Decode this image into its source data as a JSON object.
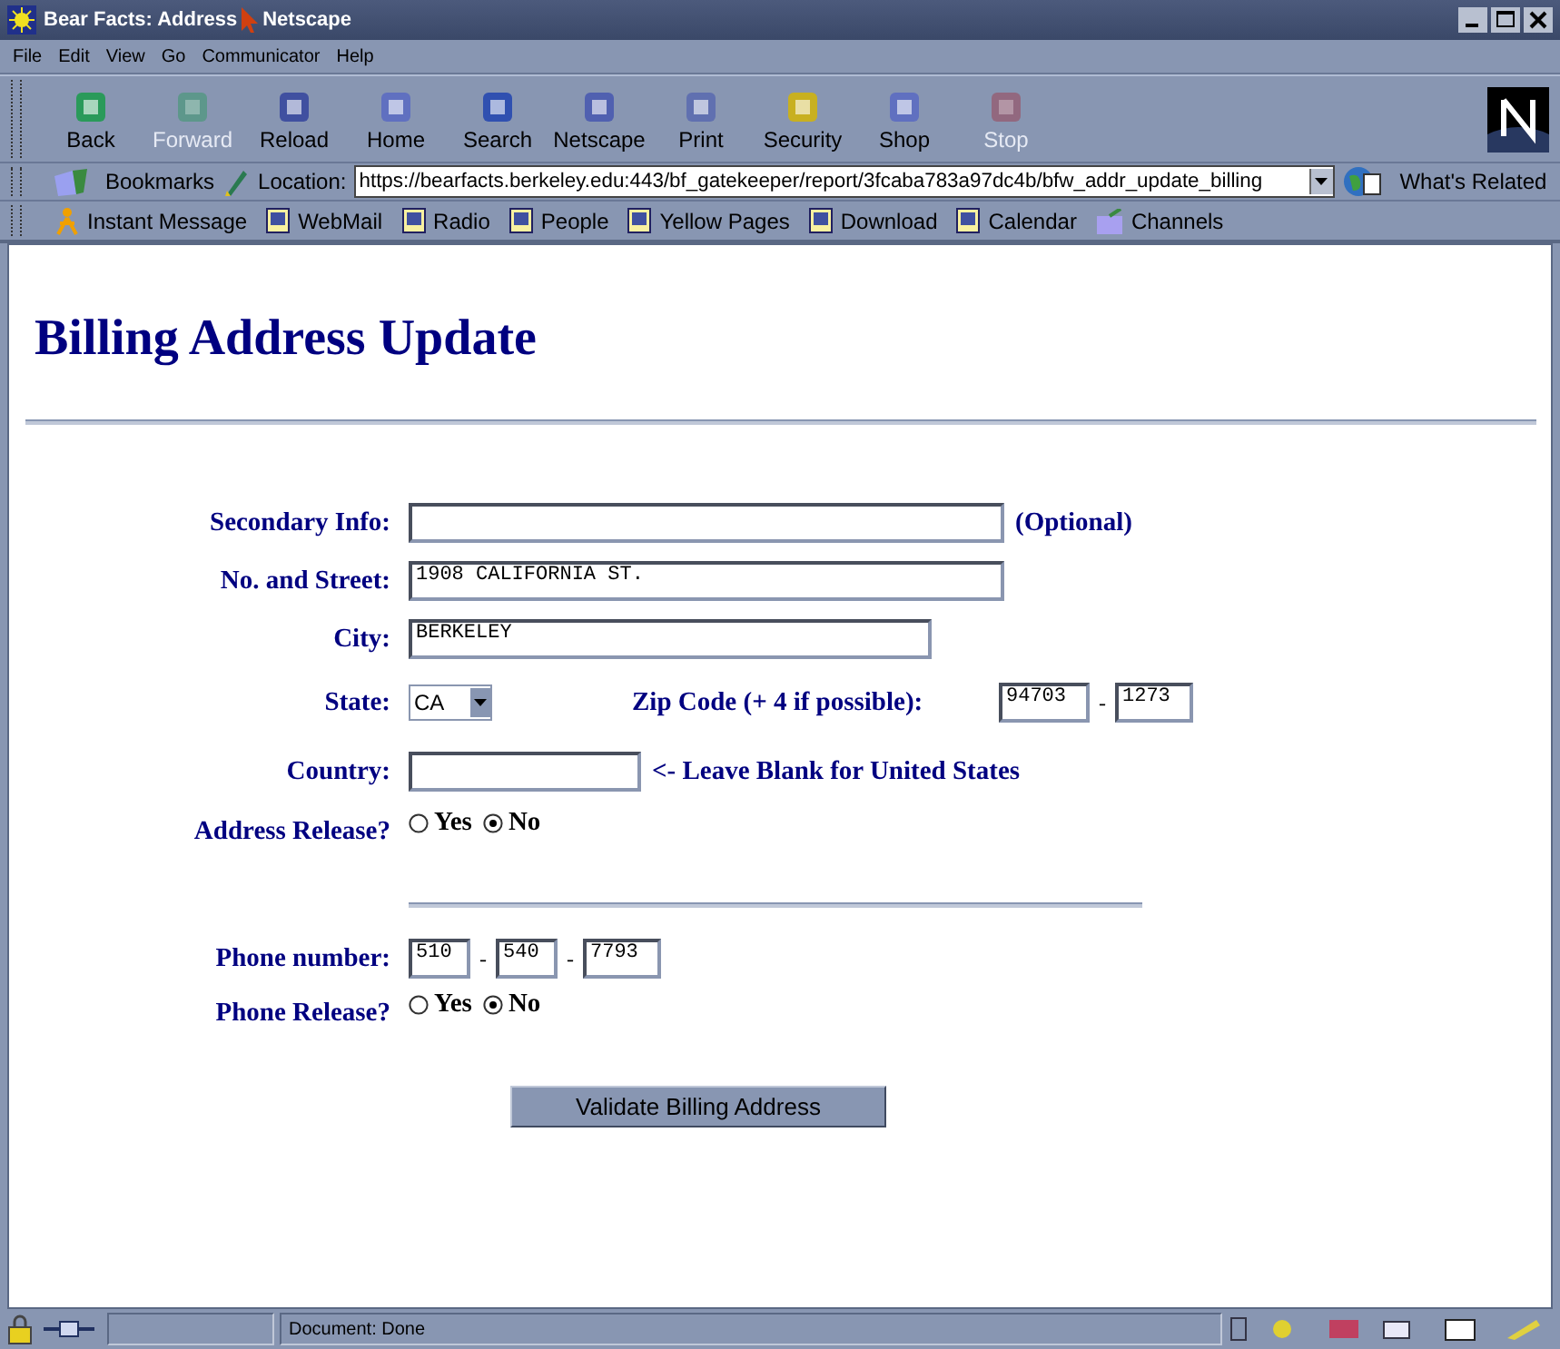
{
  "window": {
    "title": "Bear Facts: Address",
    "title_end": "Netscape"
  },
  "menu": [
    "File",
    "Edit",
    "View",
    "Go",
    "Communicator",
    "Help"
  ],
  "toolbar": [
    {
      "label": "Back",
      "disabled": false
    },
    {
      "label": "Forward",
      "disabled": true
    },
    {
      "label": "Reload",
      "disabled": false
    },
    {
      "label": "Home",
      "disabled": false
    },
    {
      "label": "Search",
      "disabled": false
    },
    {
      "label": "Netscape",
      "disabled": false
    },
    {
      "label": "Print",
      "disabled": false
    },
    {
      "label": "Security",
      "disabled": false
    },
    {
      "label": "Shop",
      "disabled": false
    },
    {
      "label": "Stop",
      "disabled": true
    }
  ],
  "location_bar": {
    "bookmarks": "Bookmarks",
    "label": "Location:",
    "url": "https://bearfacts.berkeley.edu:443/bf_gatekeeper/report/3fcaba783a97dc4b/bfw_addr_update_billing",
    "related": "What's Related"
  },
  "personal_toolbar": [
    "Instant Message",
    "WebMail",
    "Radio",
    "People",
    "Yellow Pages",
    "Download",
    "Calendar",
    "Channels"
  ],
  "page": {
    "heading": "Billing Address Update",
    "secondary": {
      "label": "Secondary Info:",
      "note": "(Optional)"
    },
    "street": {
      "label": "No. and Street:",
      "value": "1908 CALIFORNIA ST."
    },
    "city": {
      "label": "City:",
      "value": "BERKELEY"
    },
    "state": {
      "label": "State:",
      "value": "CA"
    },
    "zip": {
      "label": "Zip Code (+ 4 if possible):",
      "value": "94703",
      "plus4": "1273",
      "separator": "-"
    },
    "country": {
      "label": "Country:",
      "note": "<- Leave Blank for United States"
    },
    "address_release": {
      "label": "Address Release?",
      "options": [
        {
          "label": "Yes",
          "selected": false
        },
        {
          "label": "No",
          "selected": true
        }
      ]
    },
    "phone": {
      "label": "Phone number:",
      "parts": [
        "510",
        "540",
        "7793"
      ],
      "separators": [
        "-",
        "-"
      ]
    },
    "phone_release": {
      "label": "Phone Release?",
      "options": [
        {
          "label": "Yes",
          "selected": false
        },
        {
          "label": "No",
          "selected": true
        }
      ]
    },
    "submit": "Validate Billing Address"
  },
  "status_bar": {
    "text": "Document: Done"
  }
}
